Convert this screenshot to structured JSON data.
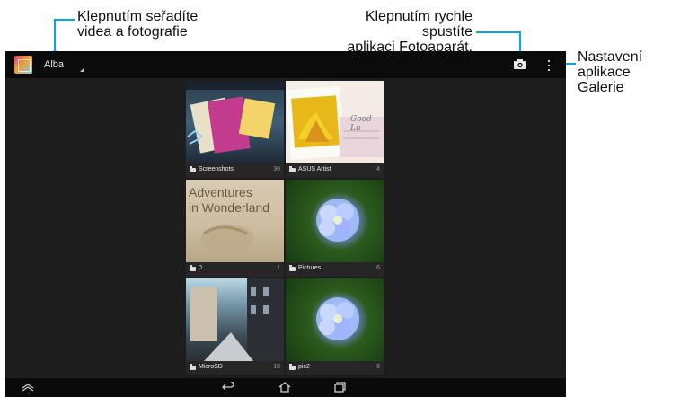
{
  "annotations": {
    "sort_line1": "Klepnutím seřadíte",
    "sort_line2": "videa a fotografie",
    "camera_line1": "Klepnutím rychle spustíte",
    "camera_line2": "aplikaci Fotoaparát.",
    "settings_line1": "Nastavení",
    "settings_line2": "aplikace Galerie"
  },
  "actionbar": {
    "title": "Alba"
  },
  "albums": [
    {
      "name": "Screenshots",
      "count": "30"
    },
    {
      "name": "ASUS Artist",
      "count": "4"
    },
    {
      "name": "0",
      "count": "1"
    },
    {
      "name": "Pictures",
      "count": "6"
    },
    {
      "name": "MicroSD",
      "count": "10"
    },
    {
      "name": "pic2",
      "count": "6"
    }
  ],
  "thumb_text": {
    "good_luck": "Good Lu",
    "adventures_line1": "Adventures",
    "adventures_line2": "in Wonderland"
  },
  "icons": [
    "gallery-app-icon",
    "camera-icon",
    "overflow-menu-icon",
    "folder-icon",
    "up-arrow-icon",
    "back-icon",
    "home-icon",
    "recent-apps-icon"
  ],
  "colors": {
    "callout_accent": "#00a9e0",
    "screen_bg": "#1d1d1d",
    "bar_bg": "#0b0b0b"
  }
}
